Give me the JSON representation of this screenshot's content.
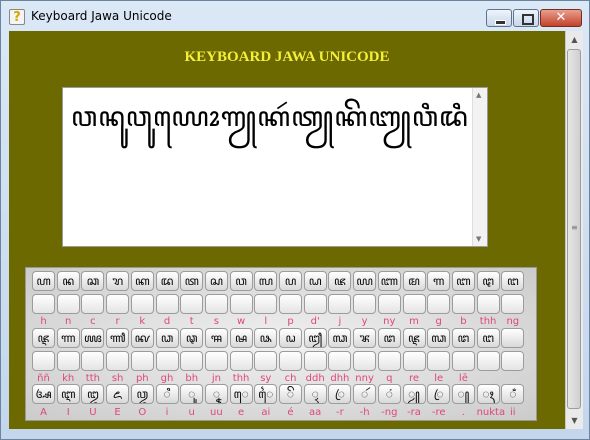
{
  "window": {
    "title": "Keyboard Jawa Unicode",
    "close_glyph": "✕"
  },
  "app": {
    "heading": "KEYBOARD JAWA UNICODE",
    "text": "ꦮꦤꦸꦮꦸꦪꦺꦴꦒꦾꦏꦂꦠꦾꦏꦼꦧꦾꦮꦶꦢꦶꦮꦸꦤꦺꦴꦒꦾ"
  },
  "keyboard": {
    "row1_keys": [
      "ꦲ",
      "ꦤ",
      "ꦕ",
      "ꦫ",
      "ꦏ",
      "ꦢ",
      "ꦠ",
      "ꦱ",
      "ꦮ",
      "ꦭ",
      "ꦥ",
      "ꦝ",
      "ꦗ",
      "ꦪ",
      "ꦚ",
      "ꦩ",
      "ꦒ",
      "ꦧ",
      "ꦛ",
      "ꦔ"
    ],
    "row2_keys": [
      "",
      "",
      "",
      "",
      "",
      "",
      "",
      "",
      "",
      "",
      "",
      "",
      "",
      "",
      "",
      "",
      "",
      "",
      "",
      ""
    ],
    "row1_labels": [
      "h",
      "n",
      "c",
      "r",
      "k",
      "d",
      "t",
      "s",
      "w",
      "l",
      "p",
      "d'",
      "j",
      "y",
      "ny",
      "m",
      "g",
      "b",
      "thh",
      "ng"
    ],
    "row3_keys": [
      "ꦘ",
      "ꦟ",
      "ꦖ",
      "ꦬ",
      "ꦑ",
      "ꦣ",
      "ꦡ",
      "ꦯ",
      "ꦰ",
      "ꦦ",
      "ꦞ",
      "ꦙ",
      "ꦓ",
      "ꦨ",
      "ꦜ",
      "ꦘ",
      "ꦓ",
      "ꦜ",
      "ꦔ",
      ""
    ],
    "row4_keys": [
      "",
      "",
      "",
      "",
      "",
      "",
      "",
      "",
      "",
      "",
      "",
      "",
      "",
      "",
      "",
      "",
      "",
      "",
      "",
      ""
    ],
    "row3_labels": [
      "ññ",
      "kh",
      "tth",
      "sh",
      "ph",
      "gh",
      "bh",
      "jn",
      "thh",
      "sy",
      "ch",
      "ddh",
      "dhh",
      "nny",
      "q",
      "re",
      "le",
      "lē",
      "",
      ""
    ],
    "row5_keys": [
      "ꦄ",
      "ꦆ",
      "ꦈ",
      "ꦌ",
      "ꦎ",
      "ꦶ",
      "ꦸ",
      "ꦹ",
      "ꦺ",
      "ꦻ",
      "ꦼ",
      "ꦽ",
      "ꦿ",
      "ꦂ",
      "ꦁ",
      "ꦾ",
      "ꦿ",
      "꧀",
      "ꦃ",
      "ꦀ"
    ],
    "row5_labels": [
      "A",
      "I",
      "U",
      "E",
      "O",
      "i",
      "u",
      "uu",
      "e",
      "ai",
      "é",
      "aa",
      "-r",
      "-h",
      "-ng",
      "-ra",
      "-re",
      ".",
      "nukta",
      "ii"
    ]
  }
}
